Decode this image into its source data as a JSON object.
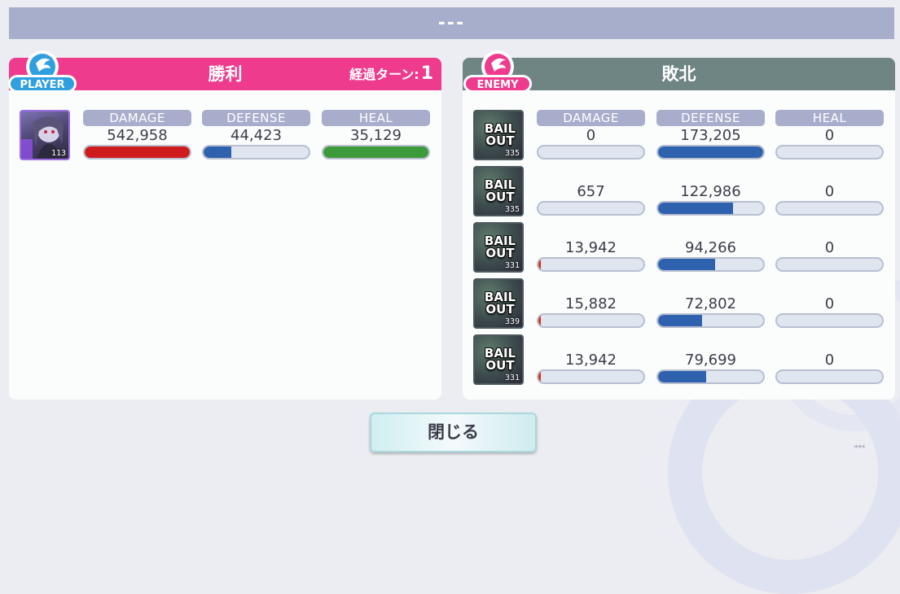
{
  "header": {
    "title": "---"
  },
  "player": {
    "badge": "PLAYER",
    "result": "勝利",
    "turn_label": "経過ターン:",
    "turn_value": "1",
    "colors": {
      "header": "#ef3b8d"
    },
    "units": [
      {
        "level": "113",
        "damage": {
          "label": "DAMAGE",
          "value": "542,958",
          "fill": 1.0
        },
        "defense": {
          "label": "DEFENSE",
          "value": "44,423",
          "fill": 0.26
        },
        "heal": {
          "label": "HEAL",
          "value": "35,129",
          "fill": 1.0
        }
      }
    ]
  },
  "enemy": {
    "badge": "ENEMY",
    "result": "敗北",
    "colors": {
      "header": "#6e8584"
    },
    "units": [
      {
        "icon_text": "BAIL OUT",
        "level": "335",
        "damage": {
          "label": "DAMAGE",
          "value": "0",
          "fill": 0
        },
        "defense": {
          "label": "DEFENSE",
          "value": "173,205",
          "fill": 1.0
        },
        "heal": {
          "label": "HEAL",
          "value": "0",
          "fill": 0
        }
      },
      {
        "icon_text": "BAIL OUT",
        "level": "335",
        "damage": {
          "value": "657",
          "fill": 0
        },
        "defense": {
          "value": "122,986",
          "fill": 0.71
        },
        "heal": {
          "value": "0",
          "fill": 0
        }
      },
      {
        "icon_text": "BAIL OUT",
        "level": "331",
        "damage": {
          "value": "13,942",
          "fill": 0.02
        },
        "defense": {
          "value": "94,266",
          "fill": 0.54
        },
        "heal": {
          "value": "0",
          "fill": 0
        }
      },
      {
        "icon_text": "BAIL OUT",
        "level": "339",
        "damage": {
          "value": "15,882",
          "fill": 0.02
        },
        "defense": {
          "value": "72,802",
          "fill": 0.42
        },
        "heal": {
          "value": "0",
          "fill": 0
        }
      },
      {
        "icon_text": "BAIL OUT",
        "level": "331",
        "damage": {
          "value": "13,942",
          "fill": 0.02
        },
        "defense": {
          "value": "79,699",
          "fill": 0.46
        },
        "heal": {
          "value": "0",
          "fill": 0
        }
      }
    ]
  },
  "close_button": {
    "label": "閉じる"
  }
}
